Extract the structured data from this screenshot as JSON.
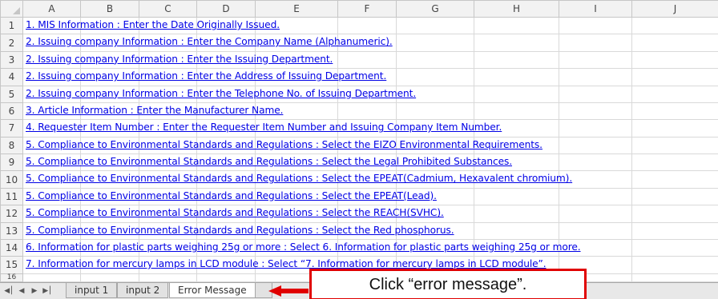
{
  "columns": [
    "A",
    "B",
    "C",
    "D",
    "E",
    "F",
    "G",
    "H",
    "I",
    "J"
  ],
  "rows": [
    {
      "num": "1",
      "text": "1. MIS Information : Enter the Date Originally Issued."
    },
    {
      "num": "2",
      "text": "2. Issuing company Information : Enter the Company Name (Alphanumeric)."
    },
    {
      "num": "3",
      "text": "2. Issuing company Information : Enter the Issuing Department."
    },
    {
      "num": "4",
      "text": "2. Issuing company Information : Enter the Address of Issuing Department."
    },
    {
      "num": "5",
      "text": "2. Issuing company Information : Enter the Telephone No. of Issuing Department."
    },
    {
      "num": "6",
      "text": "3. Article Information : Enter the Manufacturer Name."
    },
    {
      "num": "7",
      "text": "4. Requester Item Number : Enter the Requester Item Number and Issuing Company Item Number."
    },
    {
      "num": "8",
      "text": "5. Compliance to Environmental Standards and Regulations : Select the EIZO Environmental Requirements."
    },
    {
      "num": "9",
      "text": "5. Compliance to Environmental Standards and Regulations : Select the Legal Prohibited Substances."
    },
    {
      "num": "10",
      "text": "5. Compliance to Environmental Standards and Regulations : Select the EPEAT(Cadmium, Hexavalent chromium)."
    },
    {
      "num": "11",
      "text": "5. Compliance to Environmental Standards and Regulations : Select the EPEAT(Lead)."
    },
    {
      "num": "12",
      "text": "5. Compliance to Environmental Standards and Regulations : Select the REACH(SVHC)."
    },
    {
      "num": "13",
      "text": "5. Compliance to Environmental Standards and Regulations : Select the Red phosphorus."
    },
    {
      "num": "14",
      "text": "6. Information for plastic parts weighing 25g or more : Select 6. Information for plastic parts weighing 25g or more."
    },
    {
      "num": "15",
      "text": "7. Information for mercury lamps in LCD module : Select “7. Information for mercury lamps in LCD module”."
    },
    {
      "num": "16",
      "text": ""
    }
  ],
  "sheet_tabs": {
    "tab1": "input 1",
    "tab2": "input 2",
    "tab3": "Error Message"
  },
  "nav_icons": [
    "first-sheet-icon",
    "prev-sheet-icon",
    "next-sheet-icon",
    "last-sheet-icon"
  ],
  "callout": {
    "text": "Click “error message”."
  },
  "colors": {
    "link": "#0000e6",
    "highlight": "#e00000"
  }
}
